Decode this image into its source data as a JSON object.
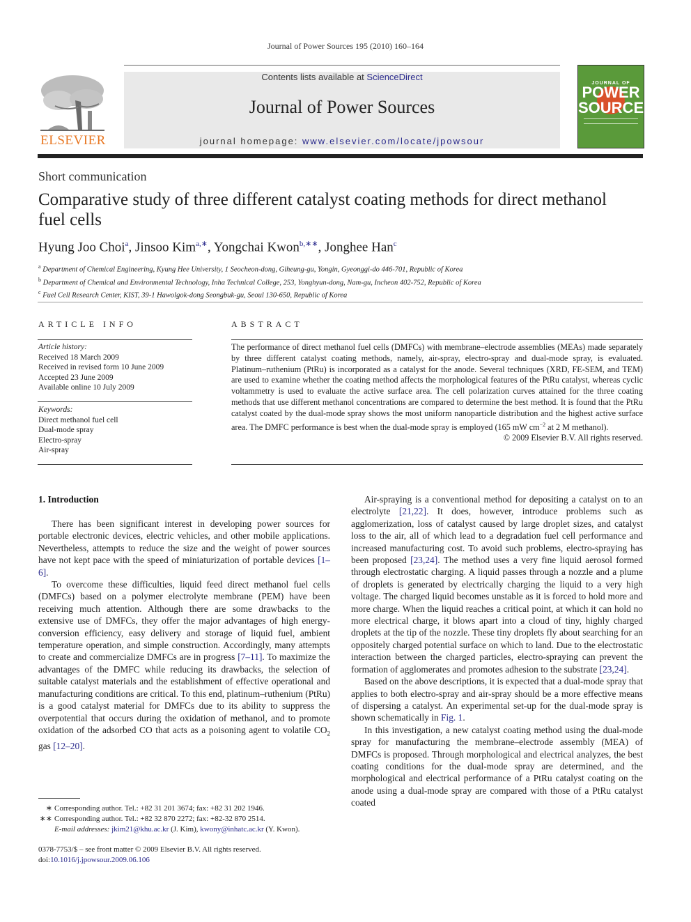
{
  "running_head": "Journal of Power Sources 195 (2010) 160–164",
  "masthead": {
    "contents_prefix": "Contents lists available at ",
    "contents_link": "ScienceDirect",
    "journal_title": "Journal of Power Sources",
    "homepage_prefix": "journal homepage: ",
    "homepage_link": "www.elsevier.com/locate/jpowsour",
    "publisher_logo_text": "ELSEVIER",
    "cover_line1": "JOURNAL OF",
    "cover_line2": "POWER",
    "cover_line3": "SOURCES"
  },
  "colors": {
    "link": "#2a2a8c",
    "elsevier_orange": "#e87722",
    "cover_green": "#5a9a3a"
  },
  "article": {
    "type": "Short communication",
    "title": "Comparative study of three different catalyst coating methods for direct methanol fuel cells",
    "authors": [
      {
        "name": "Hyung Joo Choi",
        "sup": "a"
      },
      {
        "name": "Jinsoo Kim",
        "sup": "a,∗"
      },
      {
        "name": "Yongchai Kwon",
        "sup": "b,∗∗"
      },
      {
        "name": "Jonghee Han",
        "sup": "c"
      }
    ],
    "affiliations": [
      {
        "mark": "a",
        "text": "Department of Chemical Engineering, Kyung Hee University, 1 Seocheon-dong, Giheung-gu, Yongin, Gyeonggi-do 446-701, Republic of Korea"
      },
      {
        "mark": "b",
        "text": "Department of Chemical and Environmental Technology, Inha Technical College, 253, Yonghyun-dong, Nam-gu, Incheon 402-752, Republic of Korea"
      },
      {
        "mark": "c",
        "text": "Fuel Cell Research Center, KIST, 39-1 Hawolgok-dong Seongbuk-gu, Seoul 130-650, Republic of Korea"
      }
    ]
  },
  "article_info": {
    "heading": "ARTICLE INFO",
    "history_label": "Article history:",
    "history": [
      "Received 18 March 2009",
      "Received in revised form 10 June 2009",
      "Accepted 23 June 2009",
      "Available online 10 July 2009"
    ],
    "keywords_label": "Keywords:",
    "keywords": [
      "Direct methanol fuel cell",
      "Dual-mode spray",
      "Electro-spray",
      "Air-spray"
    ]
  },
  "abstract": {
    "heading": "ABSTRACT",
    "text_1": "The performance of direct methanol fuel cells (DMFCs) with membrane–electrode assemblies (MEAs) made separately by three different catalyst coating methods, namely, air-spray, electro-spray and dual-mode spray, is evaluated. Platinum–ruthenium (PtRu) is incorporated as a catalyst for the anode. Several techniques (XRD, FE-SEM, and TEM) are used to examine whether the coating method affects the morphological features of the PtRu catalyst, whereas cyclic voltammetry is used to evaluate the active surface area. The cell polarization curves attained for the three coating methods that use different methanol concentrations are compared to determine the best method. It is found that the PtRu catalyst coated by the dual-mode spray shows the most uniform nanoparticle distribution and the highest active surface area. The DMFC performance is best when the dual-mode spray is employed (165 mW cm",
    "text_sup": "−2",
    "text_2": " at 2 M methanol).",
    "copyright": "© 2009 Elsevier B.V. All rights reserved."
  },
  "intro": {
    "heading": "1.  Introduction",
    "p1": "There has been significant interest in developing power sources for portable electronic devices, electric vehicles, and other mobile applications. Nevertheless, attempts to reduce the size and the weight of power sources have not kept pace with the speed of miniaturization of portable devices ",
    "p1_ref": "[1–6]",
    "p2_a": "To overcome these difficulties, liquid feed direct methanol fuel cells (DMFCs) based on a polymer electrolyte membrane (PEM) have been receiving much attention. Although there are some drawbacks to the extensive use of DMFCs, they offer the major advantages of high energy-conversion efficiency, easy delivery and storage of liquid fuel, ambient temperature operation, and simple construction. Accordingly, many attempts to create and commercialize DMFCs are in progress ",
    "p2_ref1": "[7–11]",
    "p2_b": ". To maximize the advantages of the DMFC while reducing its drawbacks, the selection of suitable catalyst materials and the establishment of effective operational and manufacturing conditions are critical. To this end, platinum–ruthenium (PtRu) is a good catalyst material for DMFCs due to its ability to suppress the overpotential that occurs during the oxidation of methanol, and to promote oxidation of the adsorbed CO that acts as a poisoning agent to volatile CO",
    "p2_sub": "2",
    "p2_c": " gas ",
    "p2_ref2": "[12–20]",
    "p3_a": "Air-spraying is a conventional method for depositing a catalyst on to an electrolyte ",
    "p3_ref1": "[21,22]",
    "p3_b": ". It does, however, introduce problems such as agglomerization, loss of catalyst caused by large droplet sizes, and catalyst loss to the air, all of which lead to a degradation fuel cell performance and increased manufacturing cost. To avoid such problems, electro-spraying has been proposed ",
    "p3_ref2": "[23,24]",
    "p3_c": ". The method uses a very fine liquid aerosol formed through electrostatic charging. A liquid passes through a nozzle and a plume of droplets is generated by electrically charging the liquid to a very high voltage. The charged liquid becomes unstable as it is forced to hold more and more charge. When the liquid reaches a critical point, at which it can hold no more electrical charge, it blows apart into a cloud of tiny, highly charged droplets at the tip of the nozzle. These tiny droplets fly about searching for an oppositely charged potential surface on which to land. Due to the electrostatic interaction between the charged particles, electro-spraying can prevent the formation of agglomerates and promotes adhesion to the substrate ",
    "p3_ref3": "[23,24]",
    "p4_a": "Based on the above descriptions, it is expected that a dual-mode spray that applies to both electro-spray and air-spray should be a more effective means of dispersing a catalyst. An experimental set-up for the dual-mode spray is shown schematically in ",
    "p4_ref": "Fig. 1",
    "p5": "In this investigation, a new catalyst coating method using the dual-mode spray for manufacturing the membrane–electrode assembly (MEA) of DMFCs is proposed. Through morphological and electrical analyzes, the best coating conditions for the dual-mode spray are determined, and the morphological and electrical performance of a PtRu catalyst coating on the anode using a dual-mode spray are compared with those of a PtRu catalyst coated"
  },
  "footnotes": {
    "fn1_mark": "∗",
    "fn1": "Corresponding author. Tel.: +82 31 201 3674; fax: +82 31 202 1946.",
    "fn2_mark": "∗∗",
    "fn2": "Corresponding author. Tel.: +82 32 870 2272; fax: +82-32 870 2514.",
    "email_label": "E-mail addresses:",
    "email1": "jkim21@khu.ac.kr",
    "email1_who": " (J. Kim), ",
    "email2": "kwony@inhatc.ac.kr",
    "email2_who": " (Y. Kwon).",
    "front_matter": "0378-7753/$ – see front matter © 2009 Elsevier B.V. All rights reserved.",
    "doi_label": "doi:",
    "doi": "10.1016/j.jpowsour.2009.06.106"
  }
}
